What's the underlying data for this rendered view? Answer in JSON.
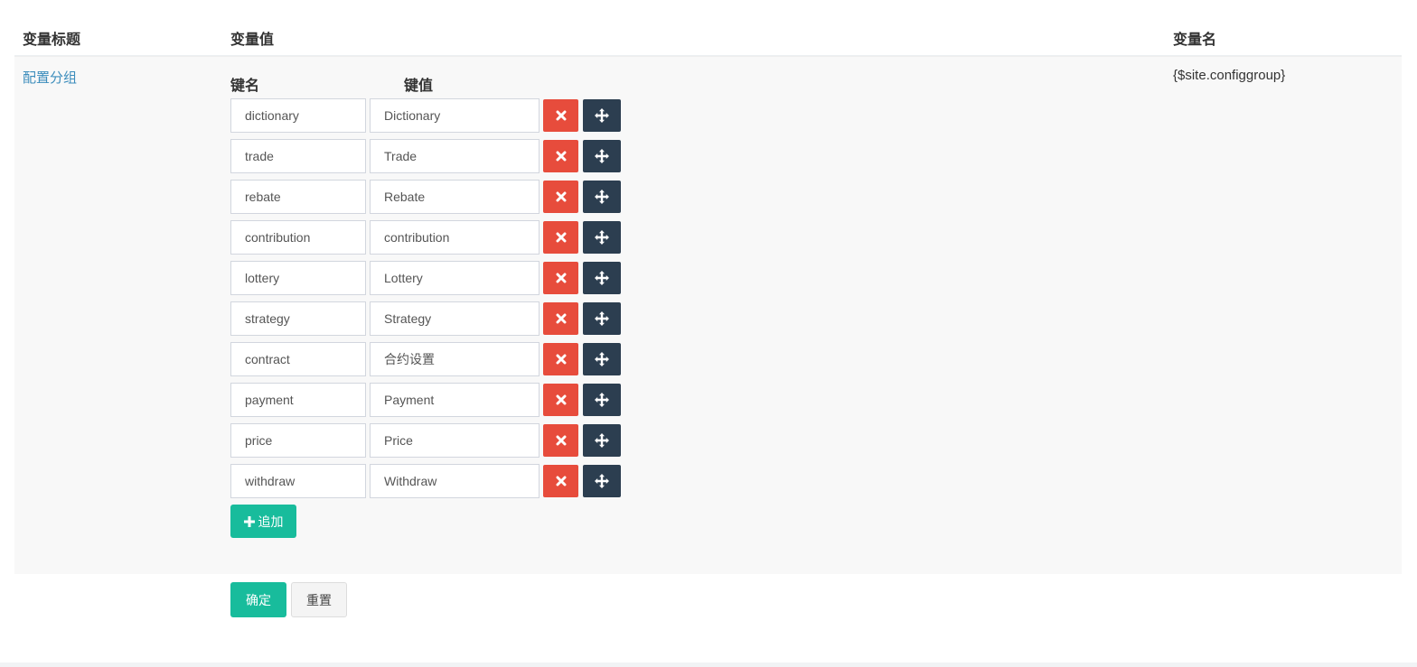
{
  "table": {
    "header_title": "变量标题",
    "header_value": "变量值",
    "header_name": "变量名"
  },
  "row": {
    "title": "配置分组",
    "variable_name": "{$site.configgroup}",
    "key_header": "键名",
    "value_header": "键值",
    "items": [
      {
        "key": "dictionary",
        "value": "Dictionary"
      },
      {
        "key": "trade",
        "value": "Trade"
      },
      {
        "key": "rebate",
        "value": "Rebate"
      },
      {
        "key": "contribution",
        "value": "contribution"
      },
      {
        "key": "lottery",
        "value": "Lottery"
      },
      {
        "key": "strategy",
        "value": "Strategy"
      },
      {
        "key": "contract",
        "value": "合约设置"
      },
      {
        "key": "payment",
        "value": "Payment"
      },
      {
        "key": "price",
        "value": "Price"
      },
      {
        "key": "withdraw",
        "value": "Withdraw"
      }
    ],
    "add_label": "追加"
  },
  "actions": {
    "ok_label": "确定",
    "reset_label": "重置"
  },
  "icons": {
    "delete": "close-icon",
    "move": "move-arrows-icon",
    "add": "plus-icon"
  },
  "colors": {
    "delete_button": "#e74c3c",
    "move_button": "#2c3e50",
    "success_button": "#18bc9c",
    "link": "#3c8dbc"
  }
}
